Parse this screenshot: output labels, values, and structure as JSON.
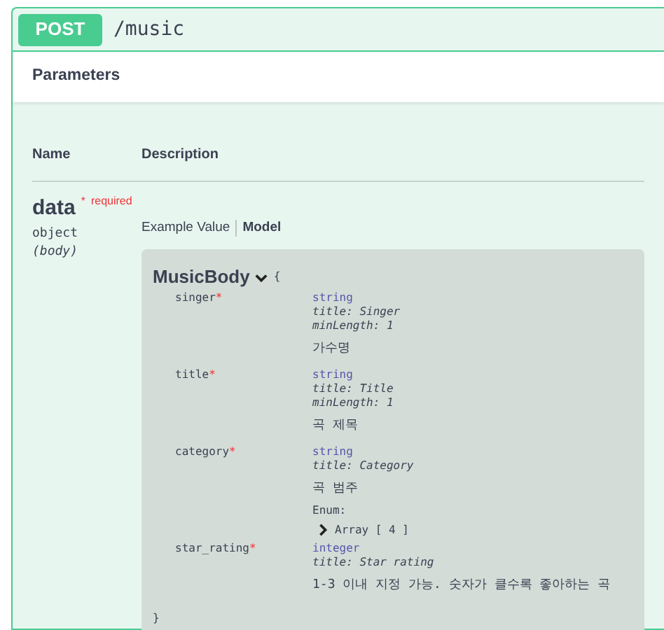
{
  "operation": {
    "method": "POST",
    "path": "/music"
  },
  "section_title": "Parameters",
  "columns": [
    "Name",
    "Description"
  ],
  "parameter": {
    "name": "data",
    "required_mark": "*",
    "required_label": "required",
    "type": "object",
    "location": "(body)",
    "tabs": [
      {
        "label": "Example Value",
        "selected": false
      },
      {
        "label": "Model",
        "selected": true
      }
    ],
    "model": {
      "name": "MusicBody",
      "expanded": true,
      "open_brace": "{",
      "close_brace": "}",
      "properties": [
        {
          "name": "singer",
          "required": true,
          "type": "string",
          "details": [
            "title: Singer",
            "minLength: 1"
          ],
          "description": "가수명"
        },
        {
          "name": "title",
          "required": true,
          "type": "string",
          "details": [
            "title: Title",
            "minLength: 1"
          ],
          "description": "곡 제목"
        },
        {
          "name": "category",
          "required": true,
          "type": "string",
          "details": [
            "title: Category"
          ],
          "description": "곡 범주",
          "enum": {
            "label": "Enum:",
            "summary": "Array [ 4 ]",
            "expanded": false
          }
        },
        {
          "name": "star_rating",
          "required": true,
          "type": "integer",
          "details": [
            "title: Star rating"
          ],
          "description": "1-3 이내 지정 가능. 숫자가 클수록 좋아하는 곡"
        }
      ]
    }
  }
}
